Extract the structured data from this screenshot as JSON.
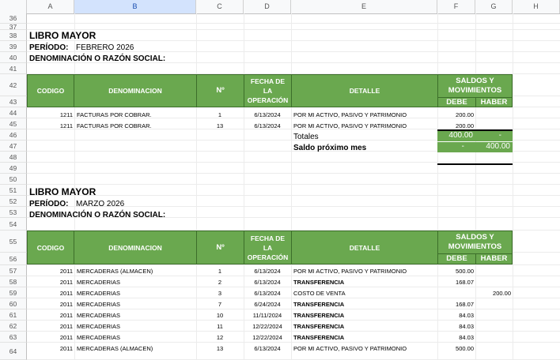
{
  "columns": [
    "A",
    "B",
    "C",
    "D",
    "E",
    "F",
    "G",
    "H"
  ],
  "rows": [
    "36",
    "37",
    "38",
    "39",
    "40",
    "41",
    "42",
    "43",
    "44",
    "45",
    "46",
    "47",
    "48",
    "49",
    "50",
    "51",
    "52",
    "53",
    "54",
    "55",
    "56",
    "57",
    "58",
    "59",
    "60",
    "61",
    "62",
    "63",
    "64"
  ],
  "table_headers": {
    "codigo": "CODIGO",
    "denominacion": "DENOMINACION",
    "numero": "Nº",
    "fecha": "FECHA DE LA OPERACIÓN",
    "detalle": "DETALLE",
    "saldos": "SALDOS Y MOVIMIENTOS",
    "debe": "DEBE",
    "haber": "HABER"
  },
  "ledger1": {
    "title": "LIBRO MAYOR",
    "periodo_label": "PERÍODO:",
    "periodo_value": "FEBRERO 2026",
    "denominacion_label": "DENOMINACIÓN O RAZÓN SOCIAL:",
    "rows": [
      {
        "codigo": "1211",
        "denominacion": "FACTURAS POR COBRAR.",
        "numero": "1",
        "fecha": "6/13/2024",
        "detalle": "POR MI ACTIVO, PASIVO Y PATRIMONIO",
        "debe": "200.00",
        "haber": ""
      },
      {
        "codigo": "1211",
        "denominacion": "FACTURAS POR COBRAR.",
        "numero": "13",
        "fecha": "6/13/2024",
        "detalle": "POR MI ACTIVO, PASIVO Y PATRIMONIO",
        "debe": "200.00",
        "haber": ""
      }
    ],
    "totales_label": "Totales",
    "totales_debe": "400.00",
    "totales_haber": "-",
    "saldo_label": "Saldo próximo mes",
    "saldo_debe": "-",
    "saldo_haber": "400.00"
  },
  "ledger2": {
    "title": "LIBRO MAYOR",
    "periodo_label": "PERÍODO:",
    "periodo_value": "MARZO 2026",
    "denominacion_label": "DENOMINACIÓN O RAZÓN SOCIAL:",
    "rows": [
      {
        "codigo": "2011",
        "denominacion": "MERCADERAS (ALMACEN)",
        "numero": "1",
        "fecha": "6/13/2024",
        "detalle": "POR MI ACTIVO, PASIVO Y PATRIMONIO",
        "detalle_bold": false,
        "debe": "500.00",
        "haber": ""
      },
      {
        "codigo": "2011",
        "denominacion": "MERCADERIAS",
        "numero": "2",
        "fecha": "6/13/2024",
        "detalle": "TRANSFERENCIA",
        "detalle_bold": true,
        "debe": "168.07",
        "haber": ""
      },
      {
        "codigo": "2011",
        "denominacion": "MERCADERIAS",
        "numero": "3",
        "fecha": "6/13/2024",
        "detalle": "COSTO DE VENTA",
        "detalle_bold": false,
        "debe": "",
        "haber": "200.00"
      },
      {
        "codigo": "2011",
        "denominacion": "MERCADERIAS",
        "numero": "7",
        "fecha": "6/24/2024",
        "detalle": "TRANSFERENCIA",
        "detalle_bold": true,
        "debe": "168.07",
        "haber": ""
      },
      {
        "codigo": "2011",
        "denominacion": "MERCADERIAS",
        "numero": "10",
        "fecha": "11/11/2024",
        "detalle": "TRANSFERENCIA",
        "detalle_bold": true,
        "debe": "84.03",
        "haber": ""
      },
      {
        "codigo": "2011",
        "denominacion": "MERCADERIAS",
        "numero": "11",
        "fecha": "12/22/2024",
        "detalle": "TRANSFERENCIA",
        "detalle_bold": true,
        "debe": "84.03",
        "haber": ""
      },
      {
        "codigo": "2011",
        "denominacion": "MERCADERIAS",
        "numero": "12",
        "fecha": "12/22/2024",
        "detalle": "TRANSFERENCIA",
        "detalle_bold": true,
        "debe": "84.03",
        "haber": ""
      },
      {
        "codigo": "2011",
        "denominacion": "MERCADERAS (ALMACEN)",
        "numero": "13",
        "fecha": "6/13/2024",
        "detalle": "POR MI ACTIVO, PASIVO Y PATRIMONIO",
        "detalle_bold": false,
        "debe": "500.00",
        "haber": ""
      }
    ]
  }
}
